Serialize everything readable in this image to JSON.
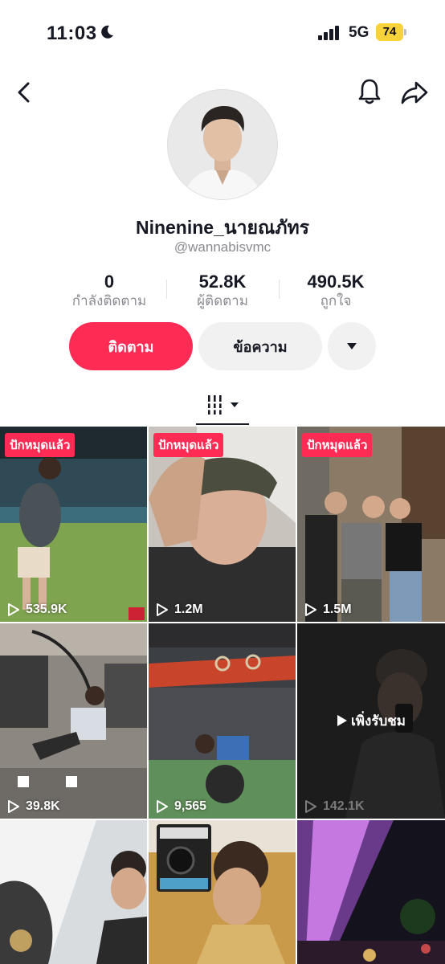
{
  "status_bar": {
    "time": "11:03",
    "network": "5G",
    "battery": "74"
  },
  "profile": {
    "username": "Ninenine_นายณภัทร",
    "handle": "@wannabisvmc"
  },
  "stats": [
    {
      "value": "0",
      "label": "กำลังติดตาม"
    },
    {
      "value": "52.8K",
      "label": "ผู้ติดตาม"
    },
    {
      "value": "490.5K",
      "label": "ถูกใจ"
    }
  ],
  "actions": {
    "follow": "ติดตาม",
    "message": "ข้อความ"
  },
  "videos": [
    {
      "pinned": "ปักหมุดแล้ว",
      "views": "535.9K"
    },
    {
      "pinned": "ปักหมุดแล้ว",
      "views": "1.2M"
    },
    {
      "pinned": "ปักหมุดแล้ว",
      "views": "1.5M"
    },
    {
      "pinned": "",
      "views": "39.8K"
    },
    {
      "pinned": "",
      "views": "9,565"
    },
    {
      "pinned": "",
      "views": "142.1K",
      "badge": "เพิ่งรับชม"
    },
    {
      "pinned": "",
      "views": ""
    },
    {
      "pinned": "",
      "views": ""
    },
    {
      "pinned": "",
      "views": ""
    }
  ],
  "colors": {
    "accent": "#fe2c55",
    "battery": "#f8d23a"
  }
}
